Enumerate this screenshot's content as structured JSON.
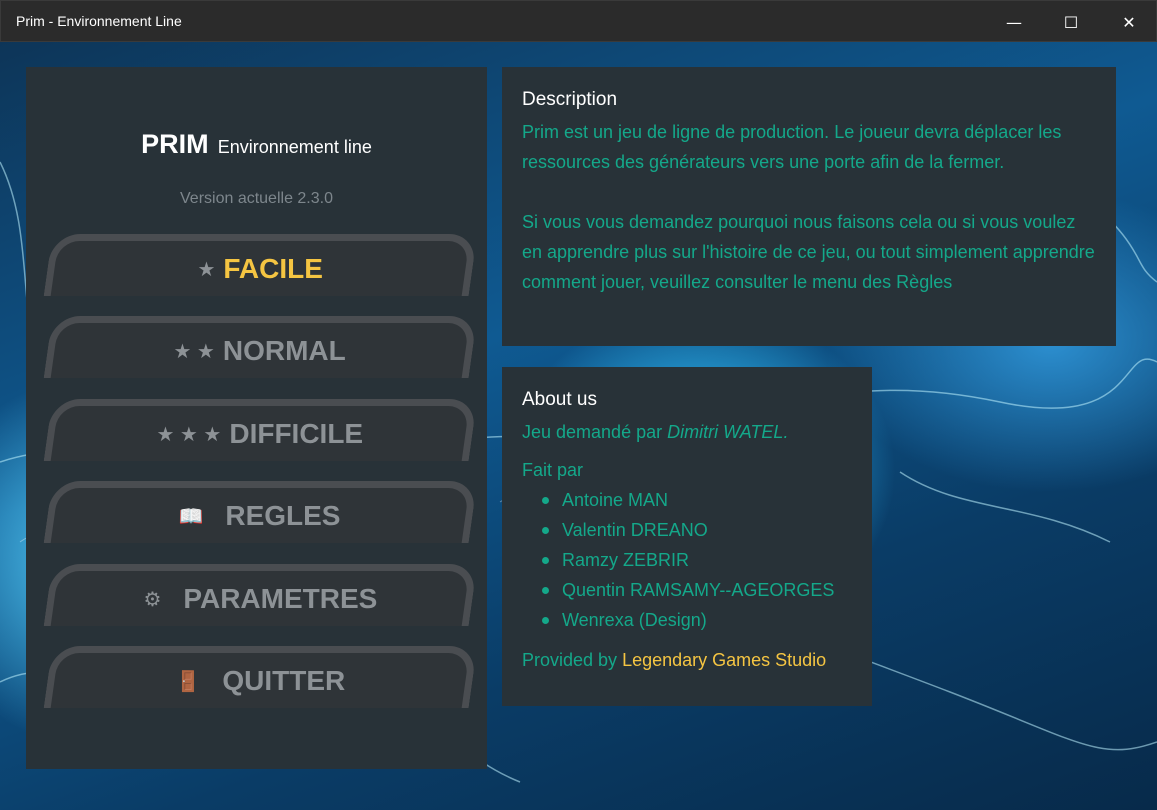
{
  "window": {
    "title": "Prim - Environnement Line",
    "minimize": "—",
    "maximize": "☐",
    "close": "✕"
  },
  "menu_panel": {
    "title_big": "PRIM",
    "title_small": "Environnement line",
    "version": "Version actuelle 2.3.0",
    "buttons": [
      {
        "label": "FACILE",
        "icon": "★",
        "active": true
      },
      {
        "label": "NORMAL",
        "icon": "★ ★",
        "active": false
      },
      {
        "label": "DIFFICILE",
        "icon": "★ ★ ★",
        "active": false
      },
      {
        "label": "REGLES",
        "icon": "📖",
        "active": false
      },
      {
        "label": "PARAMETRES",
        "icon": "⚙",
        "active": false
      },
      {
        "label": "QUITTER",
        "icon": "🚪",
        "active": false
      }
    ]
  },
  "description": {
    "heading": "Description",
    "paragraph1": "Prim est un jeu de ligne de production. Le joueur devra déplacer les ressources des générateurs vers une porte afin de la fermer.",
    "paragraph2": "Si vous vous demandez pourquoi nous faisons cela ou si vous voulez en apprendre plus sur l'histoire de ce jeu, ou tout simplement apprendre comment jouer, veuillez consulter le menu des Règles"
  },
  "about": {
    "heading": "About us",
    "requested_prefix": "Jeu demandé par ",
    "requested_by": "Dimitri WATEL.",
    "made_by_label": "Fait par",
    "credits": [
      "Antoine MAN",
      "Valentin DREANO",
      "Ramzy ZEBRIR",
      "Quentin RAMSAMY--AGEORGES",
      "Wenrexa (Design)"
    ],
    "provided_prefix": "Provided by ",
    "studio": "Legendary Games Studio"
  },
  "colors": {
    "accent_yellow": "#f5c542",
    "teal_text": "#14a88a",
    "panel_bg": "#283238"
  }
}
